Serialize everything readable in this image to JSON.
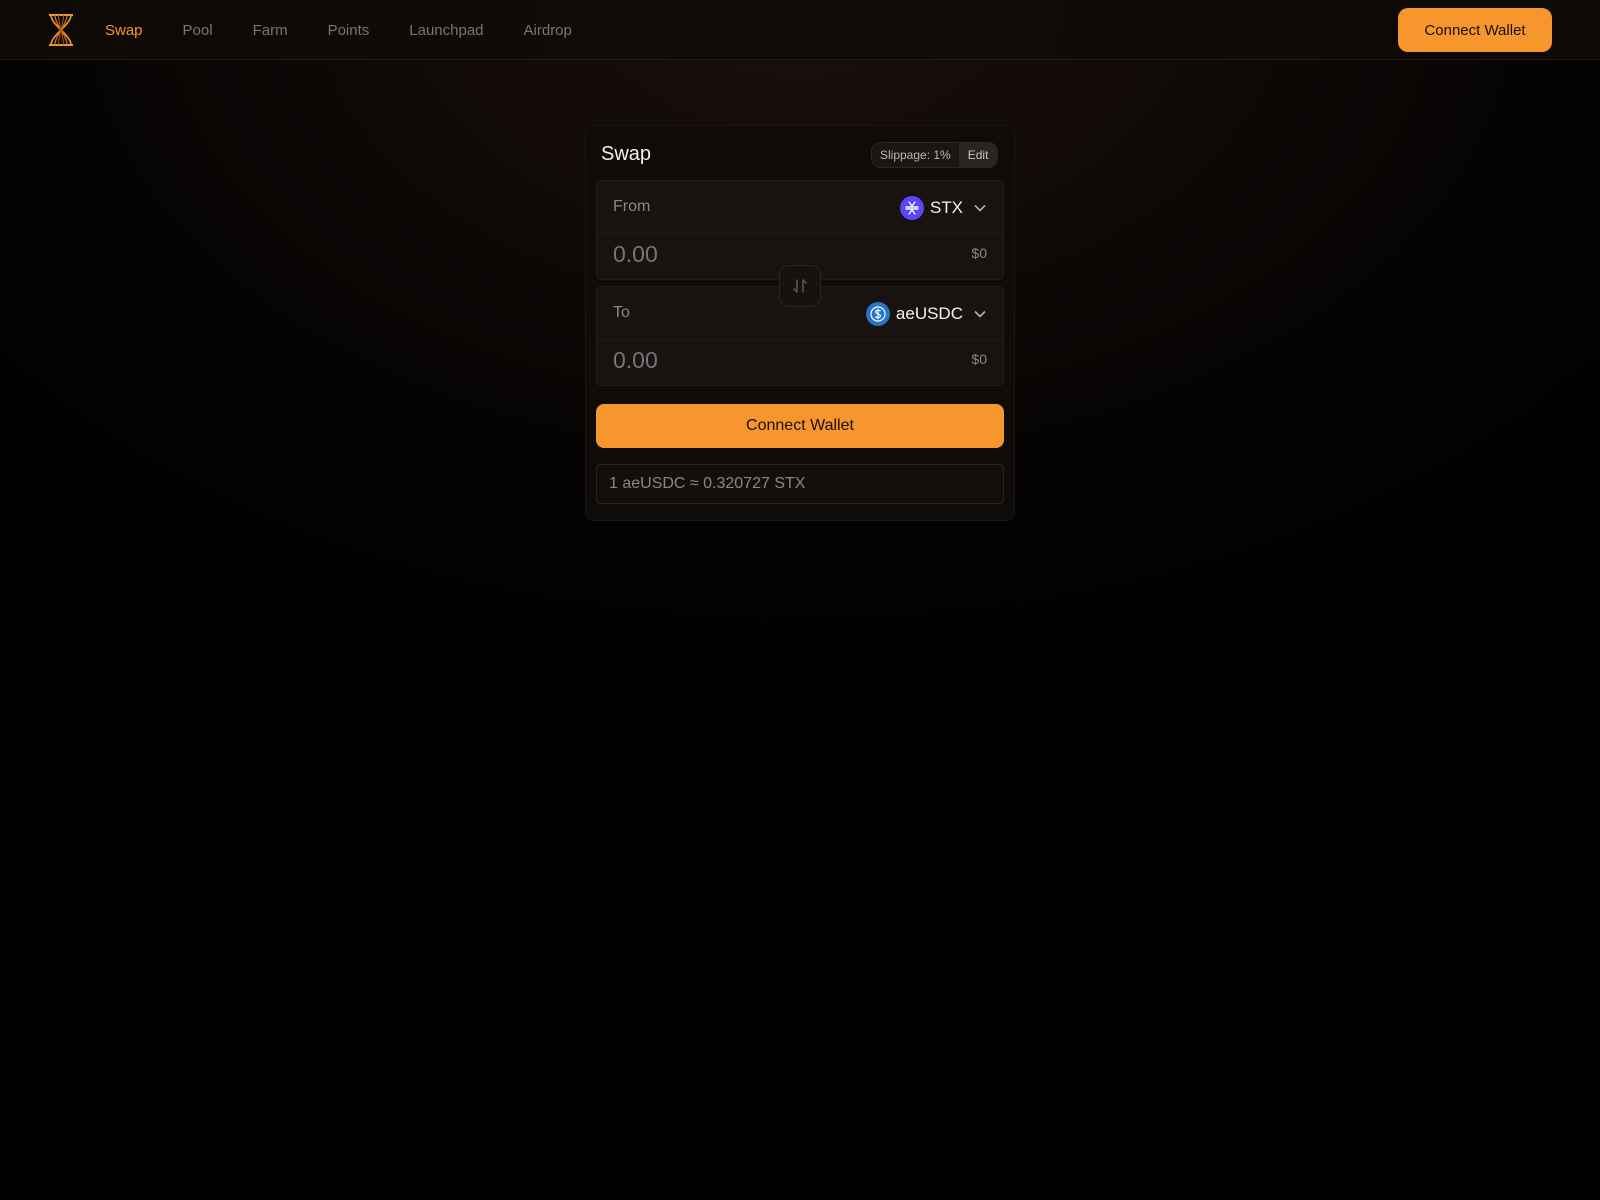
{
  "header": {
    "nav": [
      {
        "label": "Swap",
        "active": true
      },
      {
        "label": "Pool",
        "active": false
      },
      {
        "label": "Farm",
        "active": false
      },
      {
        "label": "Points",
        "active": false
      },
      {
        "label": "Launchpad",
        "active": false
      },
      {
        "label": "Airdrop",
        "active": false
      }
    ],
    "connect_label": "Connect Wallet"
  },
  "swap": {
    "title": "Swap",
    "slippage_label": "Slippage: 1%",
    "edit_label": "Edit",
    "from": {
      "label": "From",
      "token": "STX",
      "amount_placeholder": "0.00",
      "usd": "$0"
    },
    "to": {
      "label": "To",
      "token": "aeUSDC",
      "amount_placeholder": "0.00",
      "usd": "$0"
    },
    "cta_label": "Connect Wallet",
    "rate": "1 aeUSDC ≈ 0.320727 STX"
  },
  "colors": {
    "accent": "#f7962c",
    "stx": "#5546ff",
    "usdc": "#2775ca"
  },
  "icons": {
    "logo": "hourglass-logo-icon",
    "from_token": "stx-token-icon",
    "to_token": "usdc-token-icon",
    "chevron": "chevron-down-icon",
    "flip": "swap-arrows-icon"
  }
}
